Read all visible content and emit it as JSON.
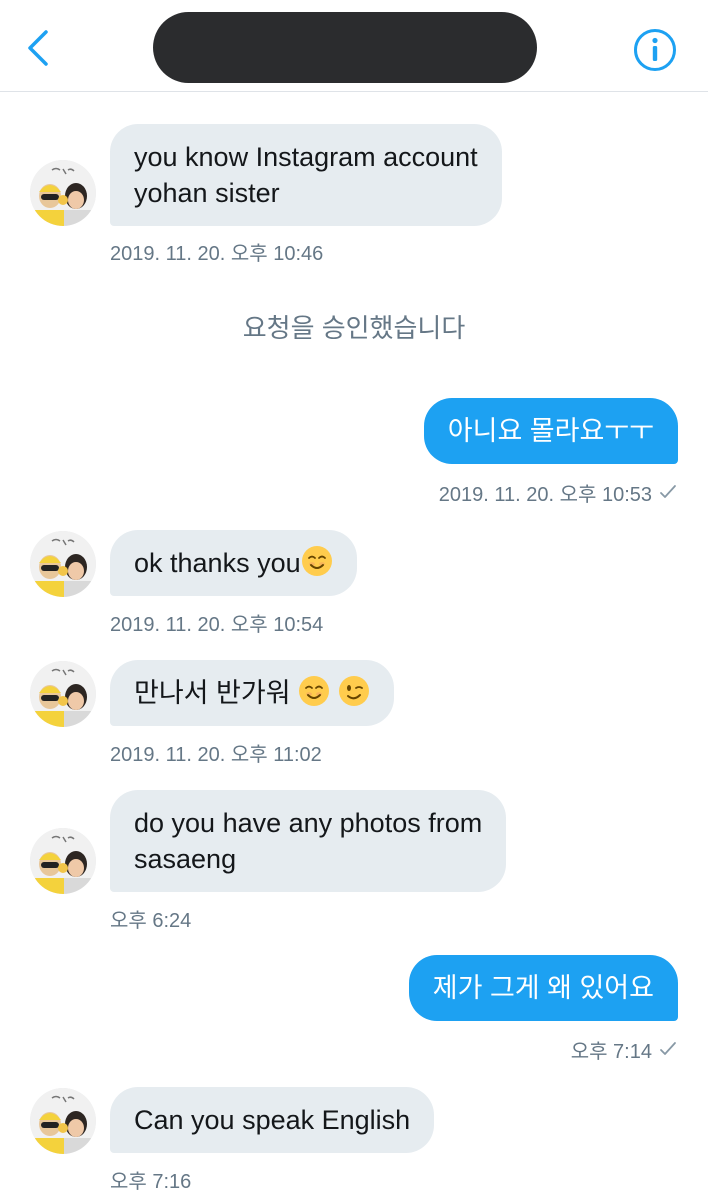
{
  "header": {
    "back_icon": "chevron-left-icon",
    "info_icon": "info-circle-icon",
    "accent_color": "#1da1f2"
  },
  "messages": [
    {
      "direction": "in",
      "text": "you know Instagram account\nyohan sister",
      "timestamp": "2019. 11. 20. 오후 10:46"
    },
    {
      "direction": "system",
      "text": "요청을 승인했습니다"
    },
    {
      "direction": "out",
      "text": "아니요 몰라요ㅜㅜ",
      "timestamp": "2019. 11. 20. 오후 10:53",
      "status": "sent-check"
    },
    {
      "direction": "in",
      "text": "ok thanks you",
      "emoji": [
        "smiling-face"
      ],
      "timestamp": "2019. 11. 20. 오후 10:54"
    },
    {
      "direction": "in",
      "text": "만나서 반가워 ",
      "emoji": [
        "smiling-face",
        "winking-face"
      ],
      "timestamp": "2019. 11. 20. 오후 11:02"
    },
    {
      "direction": "in",
      "text": "do you have any photos from\nsasaeng",
      "timestamp": "오후 6:24"
    },
    {
      "direction": "out",
      "text": "제가 그게 왜 있어요",
      "timestamp": "오후 7:14",
      "status": "sent-check"
    },
    {
      "direction": "in",
      "text": "Can you speak English",
      "timestamp": "오후 7:16"
    }
  ],
  "colors": {
    "incoming_bubble": "#e6ecf0",
    "outgoing_bubble": "#1da1f2",
    "timestamp": "#657786"
  }
}
